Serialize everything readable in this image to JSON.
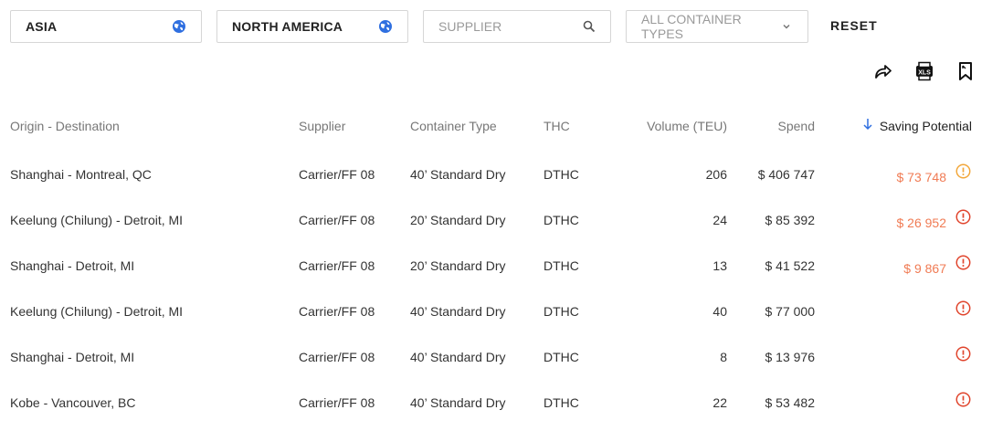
{
  "filters": {
    "origin": "ASIA",
    "destination": "NORTH AMERICA",
    "supplier_placeholder": "SUPPLIER",
    "container_types": "ALL CONTAINER TYPES",
    "reset": "RESET"
  },
  "colors": {
    "accent_blue": "#2f6fe0",
    "saving": "#f07b54",
    "warn_orange": "#f2a73a",
    "warn_red": "#e0442c"
  },
  "toolbar_icons": [
    "share-icon",
    "xls-export-icon",
    "bookmark-icon"
  ],
  "table": {
    "headers": {
      "origin_destination": "Origin - Destination",
      "supplier": "Supplier",
      "container_type": "Container Type",
      "thc": "THC",
      "volume": "Volume (TEU)",
      "spend": "Spend",
      "saving": "Saving Potential"
    },
    "sort": {
      "column": "Saving Potential",
      "direction": "descending"
    },
    "rows": [
      {
        "od": "Shanghai - Montreal, QC",
        "supplier": "Carrier/FF 08",
        "container": "40’ Standard Dry",
        "thc": "DTHC",
        "volume": "206",
        "spend": "$ 406 747",
        "saving": "$ 73 748",
        "warn": "orange"
      },
      {
        "od": "Keelung (Chilung) - Detroit, MI",
        "supplier": "Carrier/FF 08",
        "container": "20’ Standard Dry",
        "thc": "DTHC",
        "volume": "24",
        "spend": "$ 85 392",
        "saving": "$ 26 952",
        "warn": "red"
      },
      {
        "od": "Shanghai - Detroit, MI",
        "supplier": "Carrier/FF 08",
        "container": "20’ Standard Dry",
        "thc": "DTHC",
        "volume": "13",
        "spend": "$ 41 522",
        "saving": "$ 9 867",
        "warn": "red"
      },
      {
        "od": "Keelung (Chilung) - Detroit, MI",
        "supplier": "Carrier/FF 08",
        "container": "40’ Standard Dry",
        "thc": "DTHC",
        "volume": "40",
        "spend": "$ 77 000",
        "saving": "",
        "warn": "red"
      },
      {
        "od": "Shanghai - Detroit, MI",
        "supplier": "Carrier/FF 08",
        "container": "40’ Standard Dry",
        "thc": "DTHC",
        "volume": "8",
        "spend": "$ 13 976",
        "saving": "",
        "warn": "red"
      },
      {
        "od": "Kobe - Vancouver, BC",
        "supplier": "Carrier/FF 08",
        "container": "40’ Standard Dry",
        "thc": "DTHC",
        "volume": "22",
        "spend": "$ 53 482",
        "saving": "",
        "warn": "red"
      }
    ]
  }
}
